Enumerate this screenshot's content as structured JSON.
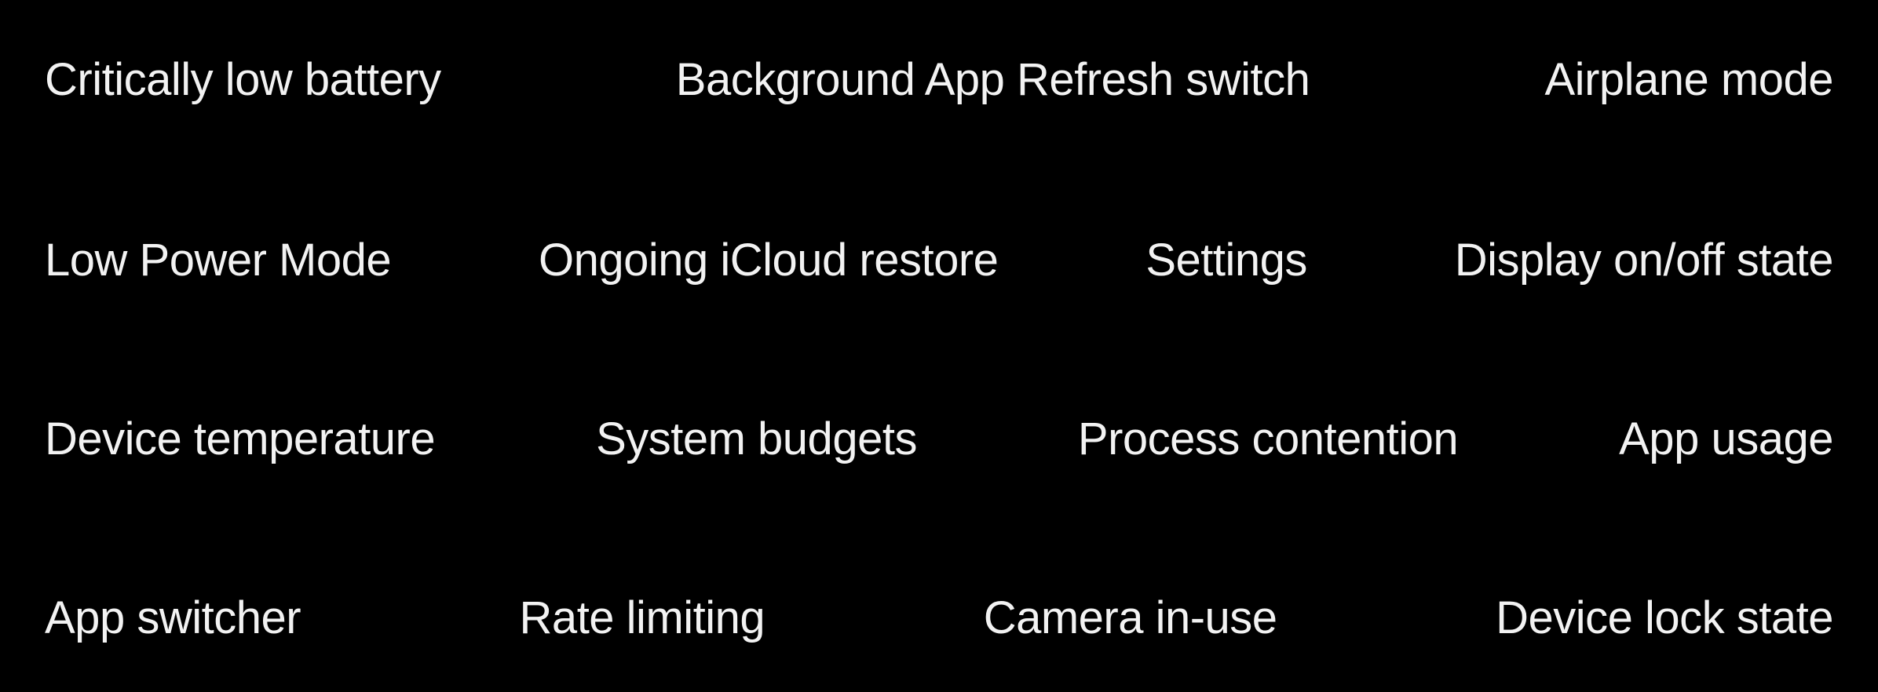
{
  "rows": [
    {
      "terms": [
        "Critically low battery",
        "Background App Refresh switch",
        "Airplane mode"
      ]
    },
    {
      "terms": [
        "Low Power Mode",
        "Ongoing iCloud restore",
        "Settings",
        "Display on/off state"
      ]
    },
    {
      "terms": [
        "Device temperature",
        "System budgets",
        "Process contention",
        "App usage"
      ]
    },
    {
      "terms": [
        "App switcher",
        "Rate limiting",
        "Camera in-use",
        "Device lock state"
      ]
    }
  ],
  "colors": {
    "background": "#000000",
    "text": "#f2f2f2"
  }
}
